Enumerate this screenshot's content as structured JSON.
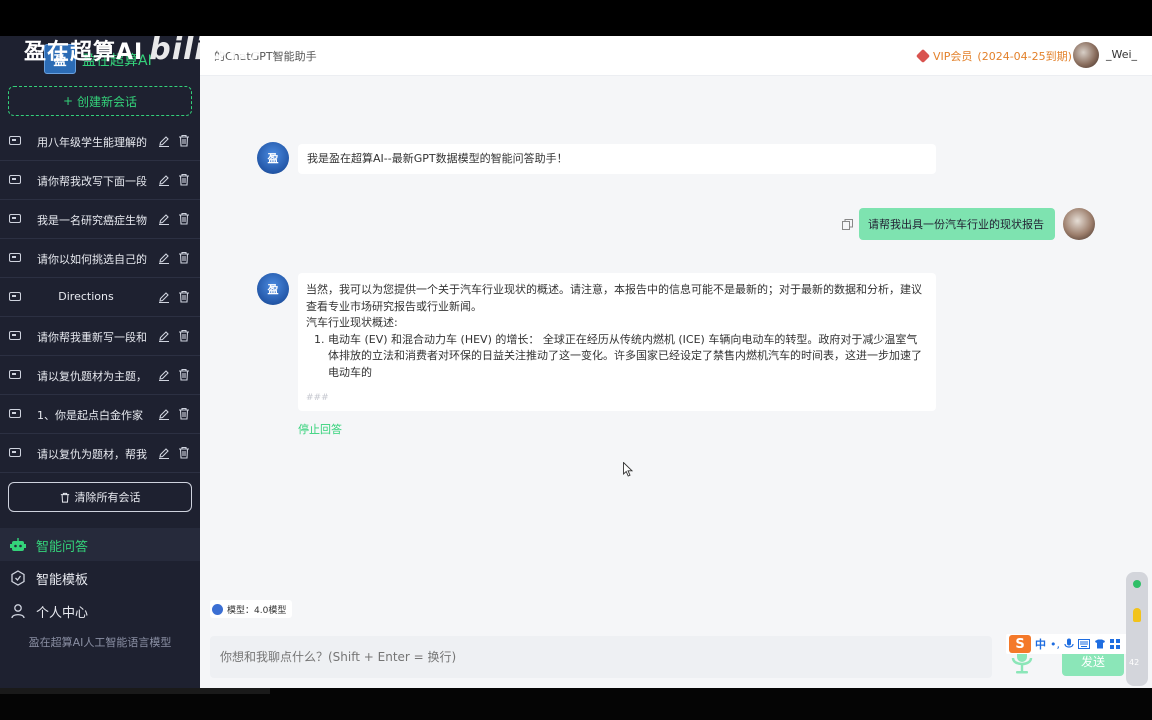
{
  "watermark": {
    "brand": "盈在超算AI",
    "site": "bilibili"
  },
  "sidebar": {
    "logo_text": "盈在超算AI",
    "logo_mark": "盈",
    "new_chat_label": "创建新会话",
    "chats": [
      {
        "label": "用八年级学生能理解的"
      },
      {
        "label": "请你帮我改写下面一段"
      },
      {
        "label": "我是一名研究癌症生物"
      },
      {
        "label": "请你以如何挑选自己的"
      },
      {
        "label": "Directions"
      },
      {
        "label": "请你帮我重新写一段和"
      },
      {
        "label": "请以复仇题材为主题，"
      },
      {
        "label": "1、你是起点白金作家"
      },
      {
        "label": "请以复仇为题材，帮我"
      }
    ],
    "clear_all_label": "清除所有会话",
    "nav": [
      {
        "label": "智能问答",
        "icon": "robot-icon"
      },
      {
        "label": "智能模板",
        "icon": "template-icon"
      },
      {
        "label": "个人中心",
        "icon": "user-icon"
      }
    ],
    "slogan": "盈在超算AI人工智能语言模型"
  },
  "header": {
    "breadcrumb": "的ChatGPT智能助手",
    "vip_label": "VIP会员",
    "vip_expiry": "(2024-04-25到期)",
    "username": "_Wei_"
  },
  "conversation": {
    "greeting": "我是盈在超算AI--最新GPT数据模型的智能问答助手！",
    "user_message": "请帮我出具一份汽车行业的现状报告",
    "answer_intro": "当然，我可以为您提供一个关于汽车行业现状的概述。请注意，本报告中的信息可能不是最新的；对于最新的数据和分析，建议查看专业市场研究报告或行业新闻。",
    "answer_heading": "汽车行业现状概述:",
    "answer_items": [
      "电动车 (EV) 和混合动力车 (HEV) 的增长： 全球正在经历从传统内燃机 (ICE) 车辆向电动车的转型。政府对于减少温室气体排放的立法和消费者对环保的日益关注推动了这一变化。许多国家已经设定了禁售内燃机汽车的时间表，这进一步加速了电动车的"
    ],
    "answer_tail": "###",
    "stop_label": "停止回答"
  },
  "composer": {
    "model_label": "模型：4.0模型",
    "placeholder": "你想和我聊点什么？(Shift + Enter = 换行)",
    "send_label": "发送"
  },
  "ime": {
    "logo": "S",
    "mode": "中",
    "punct": "•,"
  },
  "side_widget": {
    "value": "42"
  },
  "colors": {
    "accent": "#34d27a",
    "sidebar_bg": "#1e2130",
    "vip": "#e3812b",
    "user_bubble": "#7ee3b0"
  }
}
